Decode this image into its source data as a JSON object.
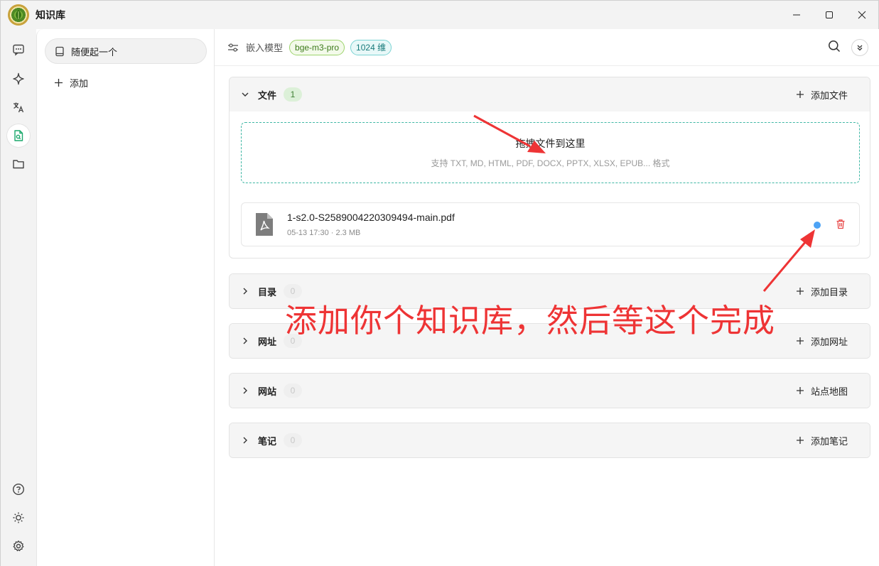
{
  "app": {
    "title": "知识库",
    "logo": "app-logo-leaf"
  },
  "window_controls": [
    "minimize-icon",
    "maximize-icon",
    "close-icon"
  ],
  "rail": {
    "top": [
      "chat-icon",
      "sparkle-icon",
      "translate-icon",
      "knowledge-base-icon",
      "folder-icon"
    ],
    "bottom": [
      "help-icon",
      "theme-icon",
      "settings-icon"
    ],
    "active": "knowledge-base-icon"
  },
  "kb_list": {
    "items": [
      {
        "label": "随便起一个",
        "icon": "book-icon"
      }
    ],
    "add_label": "添加"
  },
  "topbar": {
    "embed_label": "嵌入模型",
    "model_tag": "bge-m3-pro",
    "dim_tag": "1024 维"
  },
  "sections": {
    "files": {
      "title": "文件",
      "count": "1",
      "action": "添加文件",
      "expanded": true,
      "dropzone": {
        "title": "拖拽文件到这里",
        "hint": "支持 TXT, MD, HTML, PDF, DOCX, PPTX, XLSX, EPUB... 格式"
      },
      "items": [
        {
          "name": "1-s2.0-S2589004220309494-main.pdf",
          "meta": "05-13 17:30 · 2.3 MB",
          "status_color": "#4da3f5"
        }
      ]
    },
    "directories": {
      "title": "目录",
      "count": "0",
      "action": "添加目录"
    },
    "urls": {
      "title": "网址",
      "count": "0",
      "action": "添加网址"
    },
    "sites": {
      "title": "网站",
      "count": "0",
      "action": "站点地图"
    },
    "notes": {
      "title": "笔记",
      "count": "0",
      "action": "添加笔记"
    }
  },
  "annotation": {
    "text": "添加你个知识库，然后等这个完成",
    "color": "#ee3435"
  },
  "colors": {
    "accent": "#3fb7a4",
    "danger": "#e84747",
    "status_blue": "#4da3f5"
  }
}
